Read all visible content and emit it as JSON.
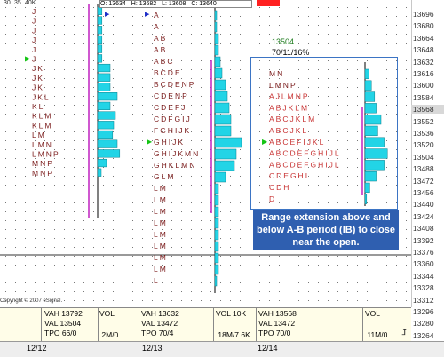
{
  "header": {
    "top_ticks": [
      "30",
      "35",
      "40K"
    ],
    "ohlc": {
      "open": "O: 13634",
      "high": "H: 13682",
      "low": "L: 13608",
      "close": "C: 13640"
    }
  },
  "price_axis": {
    "labels": [
      "13696",
      "13680",
      "13664",
      "13648",
      "13632",
      "13616",
      "13600",
      "13584",
      "13568",
      "13552",
      "13536",
      "13520",
      "13504",
      "13488",
      "13472",
      "13456",
      "13440",
      "13424",
      "13408",
      "13392",
      "13376",
      "13360",
      "13344",
      "13328",
      "13312",
      "13296",
      "13280",
      "13264"
    ],
    "highlighted": "13568"
  },
  "profiles": [
    {
      "date": "12/12",
      "letters": [
        "J",
        "J",
        "J",
        "J",
        "J",
        "J",
        "JK",
        "JK",
        "JK",
        "JKL",
        "KL",
        "KLM",
        "KLM",
        "LM",
        "LMN",
        "LMNP",
        "MNP",
        "MNP"
      ],
      "vol_bars": [
        0.12,
        0.12,
        0.12,
        0.12,
        0.12,
        0.12,
        0.35,
        0.35,
        0.35,
        0.55,
        0.35,
        0.5,
        0.45,
        0.42,
        0.55,
        0.62,
        0.25,
        0.1
      ],
      "arrow_row": 5,
      "info": {
        "vah": "VAH 13792",
        "val": "VAL 13504",
        "tpo": "TPO 66/0",
        "vol_label": "VOL",
        "vol_value": ".2M/0"
      }
    },
    {
      "date": "12/13",
      "letters": [
        "A",
        "A",
        "AB",
        "AB",
        "ABC",
        "BCDE",
        "BCDENP",
        "CDENP",
        "CDEFJ",
        "CDFGIJ",
        "FGHIJK",
        "GHIJK",
        "GHIJKMN",
        "GHKLMN",
        "GLM",
        "LM",
        "LM",
        "LM",
        "LM",
        "LM",
        "LM",
        "LM",
        "LM",
        "L"
      ],
      "vol_bars": [
        0.05,
        0.05,
        0.1,
        0.1,
        0.15,
        0.2,
        0.3,
        0.35,
        0.4,
        0.45,
        0.45,
        0.75,
        0.6,
        0.55,
        0.3,
        0.1,
        0.1,
        0.1,
        0.1,
        0.1,
        0.1,
        0.1,
        0.1,
        0.05
      ],
      "arrow_row": 11,
      "info": {
        "vah": "VAH 13632",
        "val": "VAL 13472",
        "tpo": "TPO 70/4",
        "vol_label": "VOL 10K",
        "vol_value": ".18M/7.6K"
      }
    },
    {
      "date": "12/14",
      "letters": [
        "MN",
        "LMNP",
        "AJLMNP",
        "ABJKLM",
        "ABCJKLM",
        "ABCJKL",
        "ABCEFIJKL",
        "ABCDEFGHIJL",
        "ABCDEFGHIJL",
        "CDEGHI",
        "CDH",
        "D"
      ],
      "vol_bars": [
        0.12,
        0.2,
        0.3,
        0.35,
        0.5,
        0.4,
        0.6,
        0.7,
        0.6,
        0.35,
        0.15,
        0.05
      ],
      "arrow_row": 6,
      "info": {
        "vah": "VAH 13568",
        "val": "VAL 13472",
        "tpo": "TPO 70/0",
        "vol_label": "VOL",
        "vol_value": ".11M/0"
      }
    }
  ],
  "day_stats": {
    "price": "13504",
    "stats": "70/11/16%"
  },
  "annotation": "Range extension above and below A-B period (IB) to close near the open.",
  "copyright": "Copyright © 2007 eSignal.",
  "colors": {
    "letter_red": "#c83232",
    "letter_dark": "#7a1a1a",
    "bar_cyan": "#22d4e6",
    "magenta_line": "#c020c0",
    "box_blue": "#3b74c4",
    "callout_blue": "#2f5fb0"
  }
}
